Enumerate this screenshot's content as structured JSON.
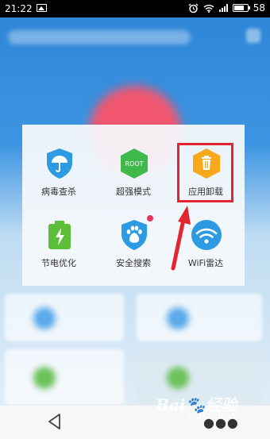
{
  "status_bar": {
    "time": "21:22",
    "battery_percent": "58",
    "icons": [
      "image-icon",
      "alarm-icon",
      "wifi-icon",
      "signal-icon",
      "battery-icon"
    ]
  },
  "menu": {
    "items": [
      {
        "label": "病毒查杀",
        "icon": "shield-umbrella-icon",
        "color": "#2d9be3"
      },
      {
        "label": "超强模式",
        "icon": "root-hexagon-icon",
        "color": "#3fb94a",
        "icon_text": "ROOT"
      },
      {
        "label": "应用卸载",
        "icon": "trash-hexagon-icon",
        "color": "#f7a81b",
        "highlighted": true
      },
      {
        "label": "节电优化",
        "icon": "battery-charging-icon",
        "color": "#5cbf3a"
      },
      {
        "label": "安全搜索",
        "icon": "paw-shield-icon",
        "color": "#2d9be3",
        "badge": true
      },
      {
        "label": "WiFi雷达",
        "icon": "wifi-radar-icon",
        "color": "#2d9be3"
      }
    ]
  },
  "annotation": {
    "color": "#e3262e"
  },
  "watermark": {
    "text": "Bai",
    "sub": "jingyan.baidu.com"
  }
}
